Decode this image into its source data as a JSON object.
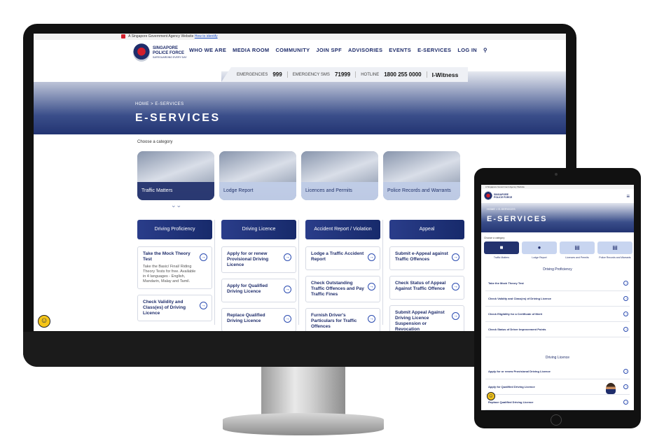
{
  "gov_bar": {
    "text": "A Singapore Government Agency Website",
    "link": "How to identify"
  },
  "logo": {
    "line1": "SINGAPORE",
    "line2": "POLICE FORCE",
    "tagline": "SAFEGUARDING EVERY DAY"
  },
  "nav": [
    "WHO WE ARE",
    "MEDIA ROOM",
    "COMMUNITY",
    "JOIN SPF",
    "ADVISORIES",
    "EVENTS",
    "E-SERVICES",
    "LOG IN"
  ],
  "emergency": {
    "emergencies_label": "EMERGENCIES",
    "emergencies_num": "999",
    "sms_label": "EMERGENCY SMS",
    "sms_num": "71999",
    "hotline_label": "HOTLINE",
    "hotline_num": "1800 255 0000",
    "iwitness": "I-Witness"
  },
  "breadcrumb": "HOME > E-SERVICES",
  "page_title": "E-SERVICES",
  "choose_category": "Choose a category",
  "categories": [
    {
      "label": "Traffic Matters",
      "icon": "car-icon"
    },
    {
      "label": "Lodge Report",
      "icon": "officer-icon"
    },
    {
      "label": "Licences and Permits",
      "icon": "document-icon"
    },
    {
      "label": "Police Records and Warrants",
      "icon": "file-icon"
    }
  ],
  "columns": [
    {
      "title": "Driving Proficiency",
      "items": [
        {
          "title": "Take the Mock Theory Test",
          "desc": "Take the Basic/ Final/ Riding Theory Tests for free. Available in 4 languages - English, Mandarin, Malay and Tamil."
        },
        {
          "title": "Check Validity and Class(es) of Driving Licence",
          "desc": ""
        }
      ]
    },
    {
      "title": "Driving Licence",
      "items": [
        {
          "title": "Apply for or renew Provisional Driving Licence",
          "desc": ""
        },
        {
          "title": "Apply for Qualified Driving Licence",
          "desc": ""
        },
        {
          "title": "Replace Qualified Driving Licence",
          "desc": ""
        }
      ]
    },
    {
      "title": "Accident Report / Violation",
      "items": [
        {
          "title": "Lodge a Traffic Accident Report",
          "desc": ""
        },
        {
          "title": "Check Outstanding Traffic Offences and Pay Traffic Fines",
          "desc": ""
        },
        {
          "title": "Furnish Driver's Particulars for Traffic Offences",
          "desc": ""
        }
      ]
    },
    {
      "title": "Appeal",
      "items": [
        {
          "title": "Submit e-Appeal against Traffic Offences",
          "desc": ""
        },
        {
          "title": "Check Status of Appeal Against Traffic Offence",
          "desc": ""
        },
        {
          "title": "Submit Appeal Against Driving Licence Suspension or Revocation",
          "desc": ""
        }
      ]
    }
  ],
  "tablet": {
    "section1": "Driving Proficiency",
    "section1_items": [
      "Take the Mock Theory Test",
      "Check Validity and Class(es) of Driving Licence",
      "Check Eligibility for a Certificate of Merit",
      "Check Status of Driver Improvement Points"
    ],
    "section2": "Driving Licence",
    "section2_items": [
      "Apply for or renew Provisional Driving Licence",
      "Apply for Qualified Driving Licence",
      "Replace Qualified Driving Licence"
    ]
  }
}
